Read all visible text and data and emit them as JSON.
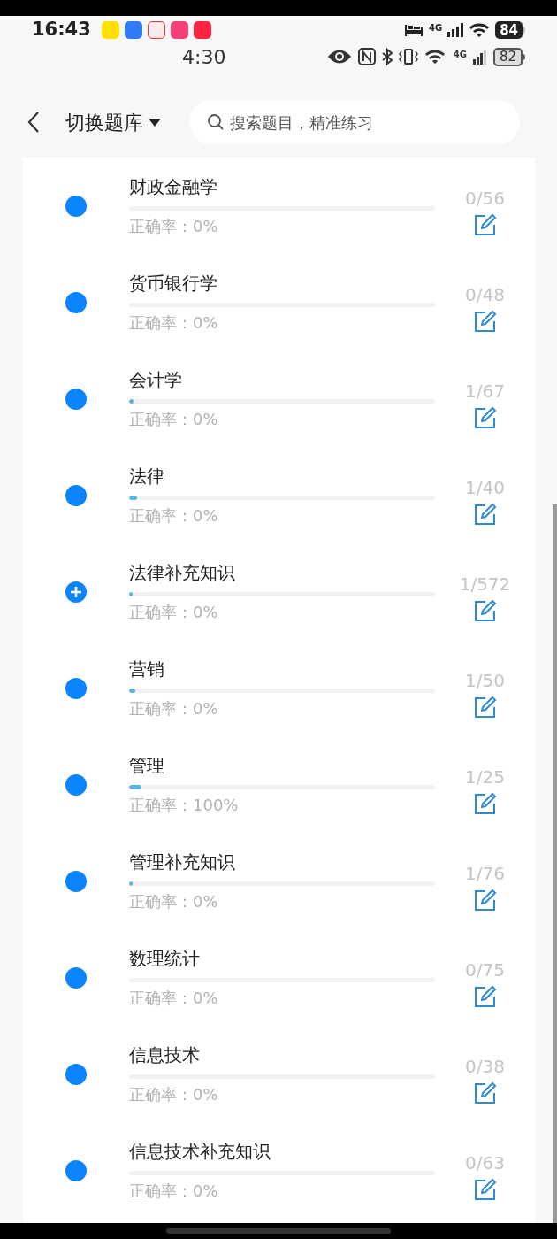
{
  "status_bar": {
    "time": "16:43",
    "network": "4G",
    "battery": "84"
  },
  "status_bar_2": {
    "time": "4:30",
    "network": "4G",
    "battery": "82"
  },
  "header": {
    "title": "切换题库",
    "search": {
      "placeholder": "搜索题目，精准练习"
    }
  },
  "subjects": [
    {
      "kind": "dot",
      "name": "财政金融学",
      "accuracy": "正确率：0%",
      "count": "0/56",
      "level": 0
    },
    {
      "kind": "dot",
      "name": "货币银行学",
      "accuracy": "正确率：0%",
      "count": "0/48",
      "level": 0
    },
    {
      "kind": "dot",
      "name": "会计学",
      "accuracy": "正确率：0%",
      "count": "1/67",
      "level": 0.015
    },
    {
      "kind": "dot",
      "name": "法律",
      "accuracy": "正确率：0%",
      "count": "1/40",
      "level": 0.025
    },
    {
      "kind": "plus",
      "name": "法律补充知识",
      "accuracy": "正确率：0%",
      "count": "1/572",
      "level": 0.002
    },
    {
      "kind": "dot",
      "name": "营销",
      "accuracy": "正确率：0%",
      "count": "1/50",
      "level": 0.02
    },
    {
      "kind": "dot",
      "name": "管理",
      "accuracy": "正确率：100%",
      "count": "1/25",
      "level": 0.04
    },
    {
      "kind": "dot",
      "name": "管理补充知识",
      "accuracy": "正确率：0%",
      "count": "1/76",
      "level": 0.013
    },
    {
      "kind": "dot",
      "name": "数理统计",
      "accuracy": "正确率：0%",
      "count": "0/75",
      "level": 0
    },
    {
      "kind": "dot",
      "name": "信息技术",
      "accuracy": "正确率：0%",
      "count": "0/38",
      "level": 0
    },
    {
      "kind": "dot",
      "name": "信息技术补充知识",
      "accuracy": "正确率：0%",
      "count": "0/63",
      "level": 0
    }
  ]
}
